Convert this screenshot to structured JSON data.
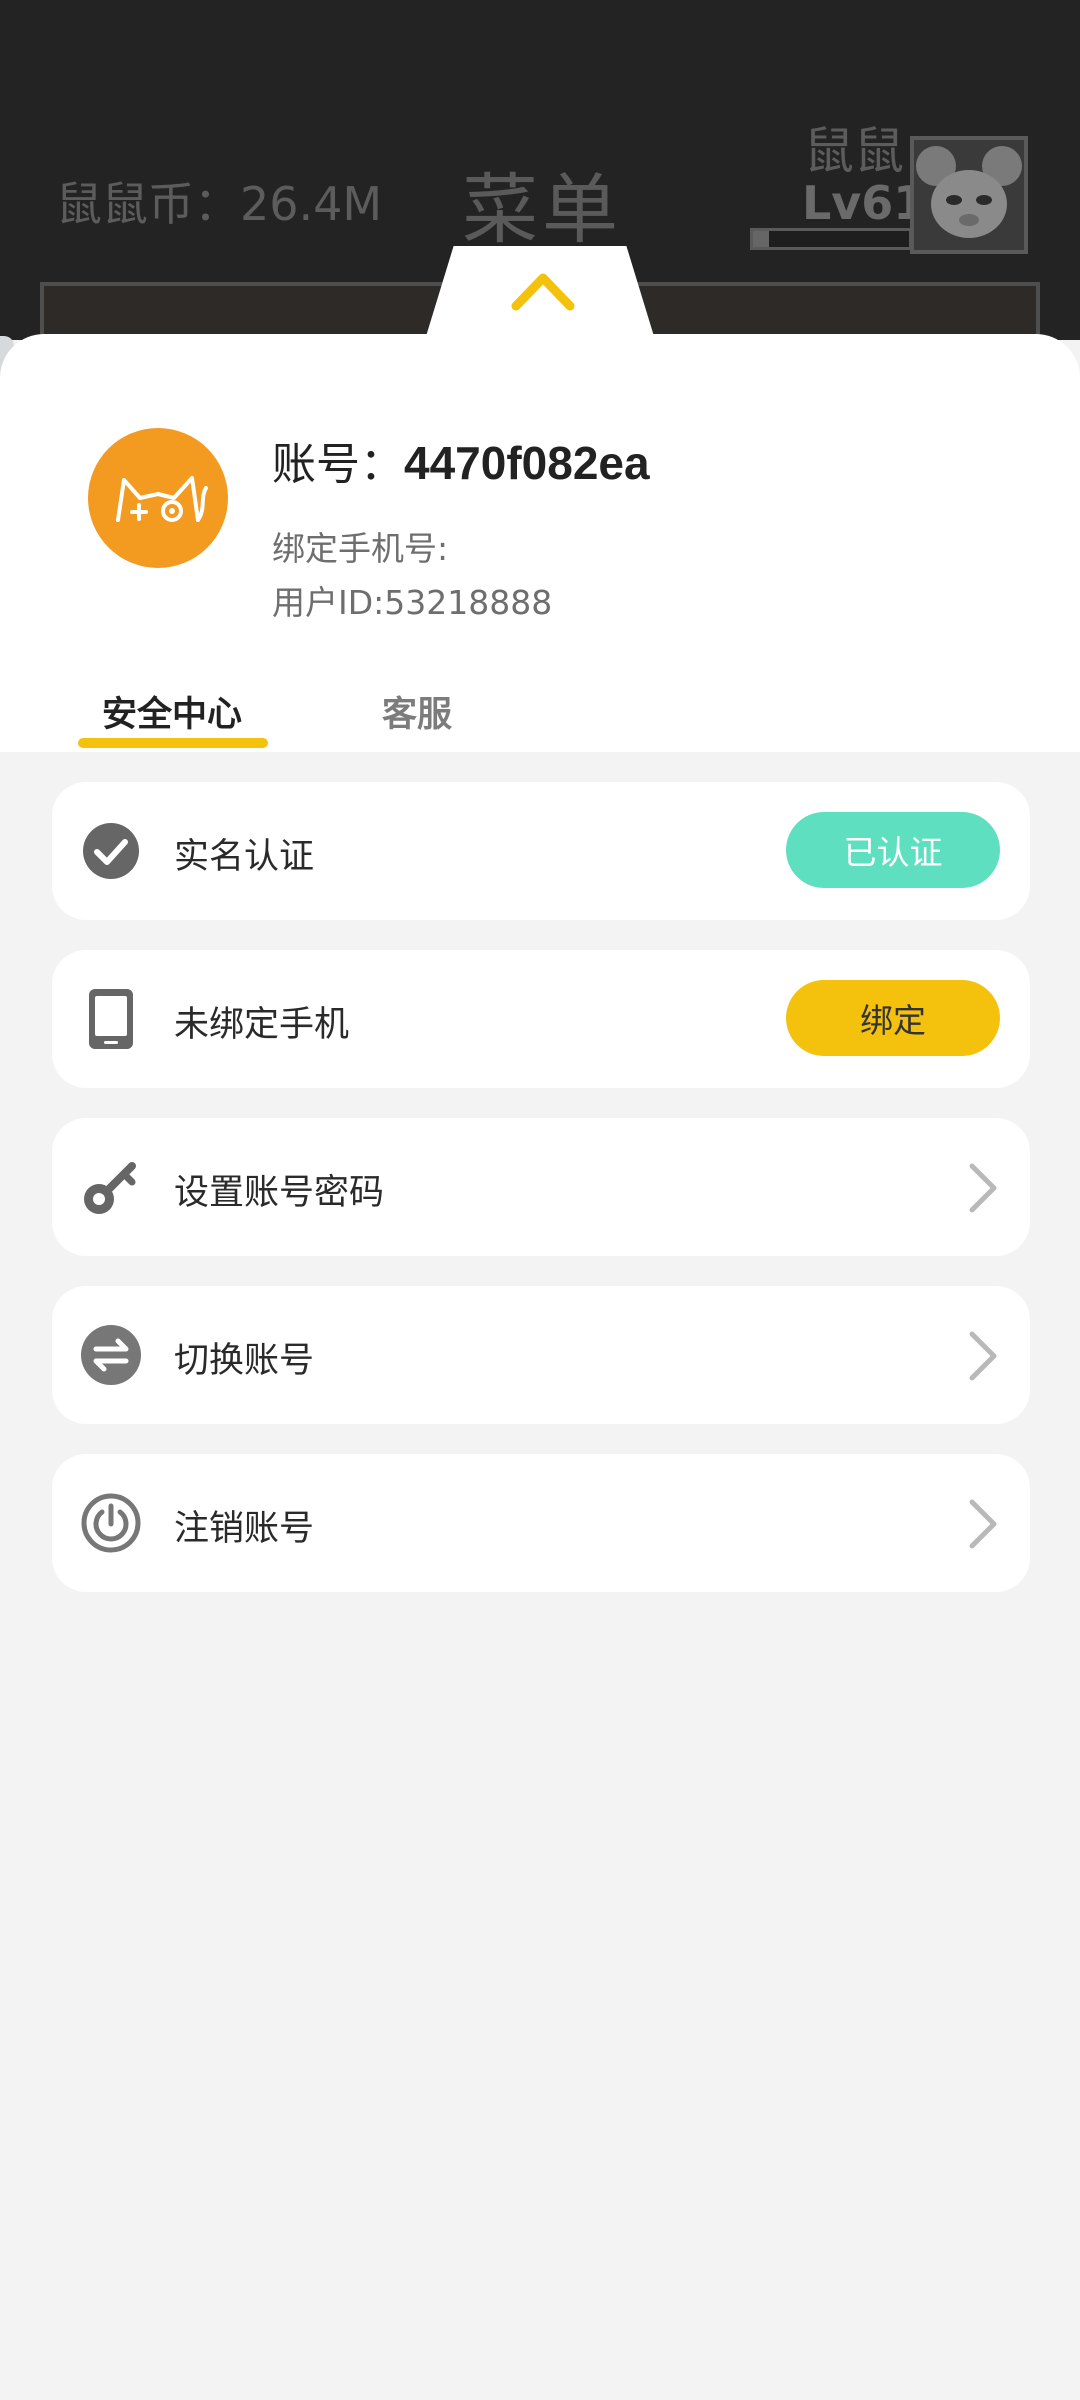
{
  "background": {
    "coins_text": "鼠鼠币：26.4M",
    "menu_title": "菜单",
    "player_name": "鼠鼠",
    "player_level": "Lv61",
    "xp_progress": 0.1
  },
  "profile": {
    "account_label": "账号：",
    "account_id": "4470f082ea",
    "phone_text": "绑定手机号:",
    "user_id_text": "用户ID:53218888"
  },
  "tabs": [
    {
      "label": "安全中心",
      "active": true
    },
    {
      "label": "客服",
      "active": false
    }
  ],
  "items": [
    {
      "label": "实名认证",
      "icon": "check-circle-icon",
      "action": "已认证"
    },
    {
      "label": "未绑定手机",
      "icon": "phone-icon",
      "action": "绑定"
    },
    {
      "label": "设置账号密码",
      "icon": "key-icon"
    },
    {
      "label": "切换账号",
      "icon": "switch-icon"
    },
    {
      "label": "注销账号",
      "icon": "power-icon"
    }
  ],
  "colors": {
    "accent_yellow": "#f4c20d",
    "verified_teal": "#5ee0c0",
    "avatar_orange": "#f39a20",
    "page_bg": "#f3f3f3"
  }
}
